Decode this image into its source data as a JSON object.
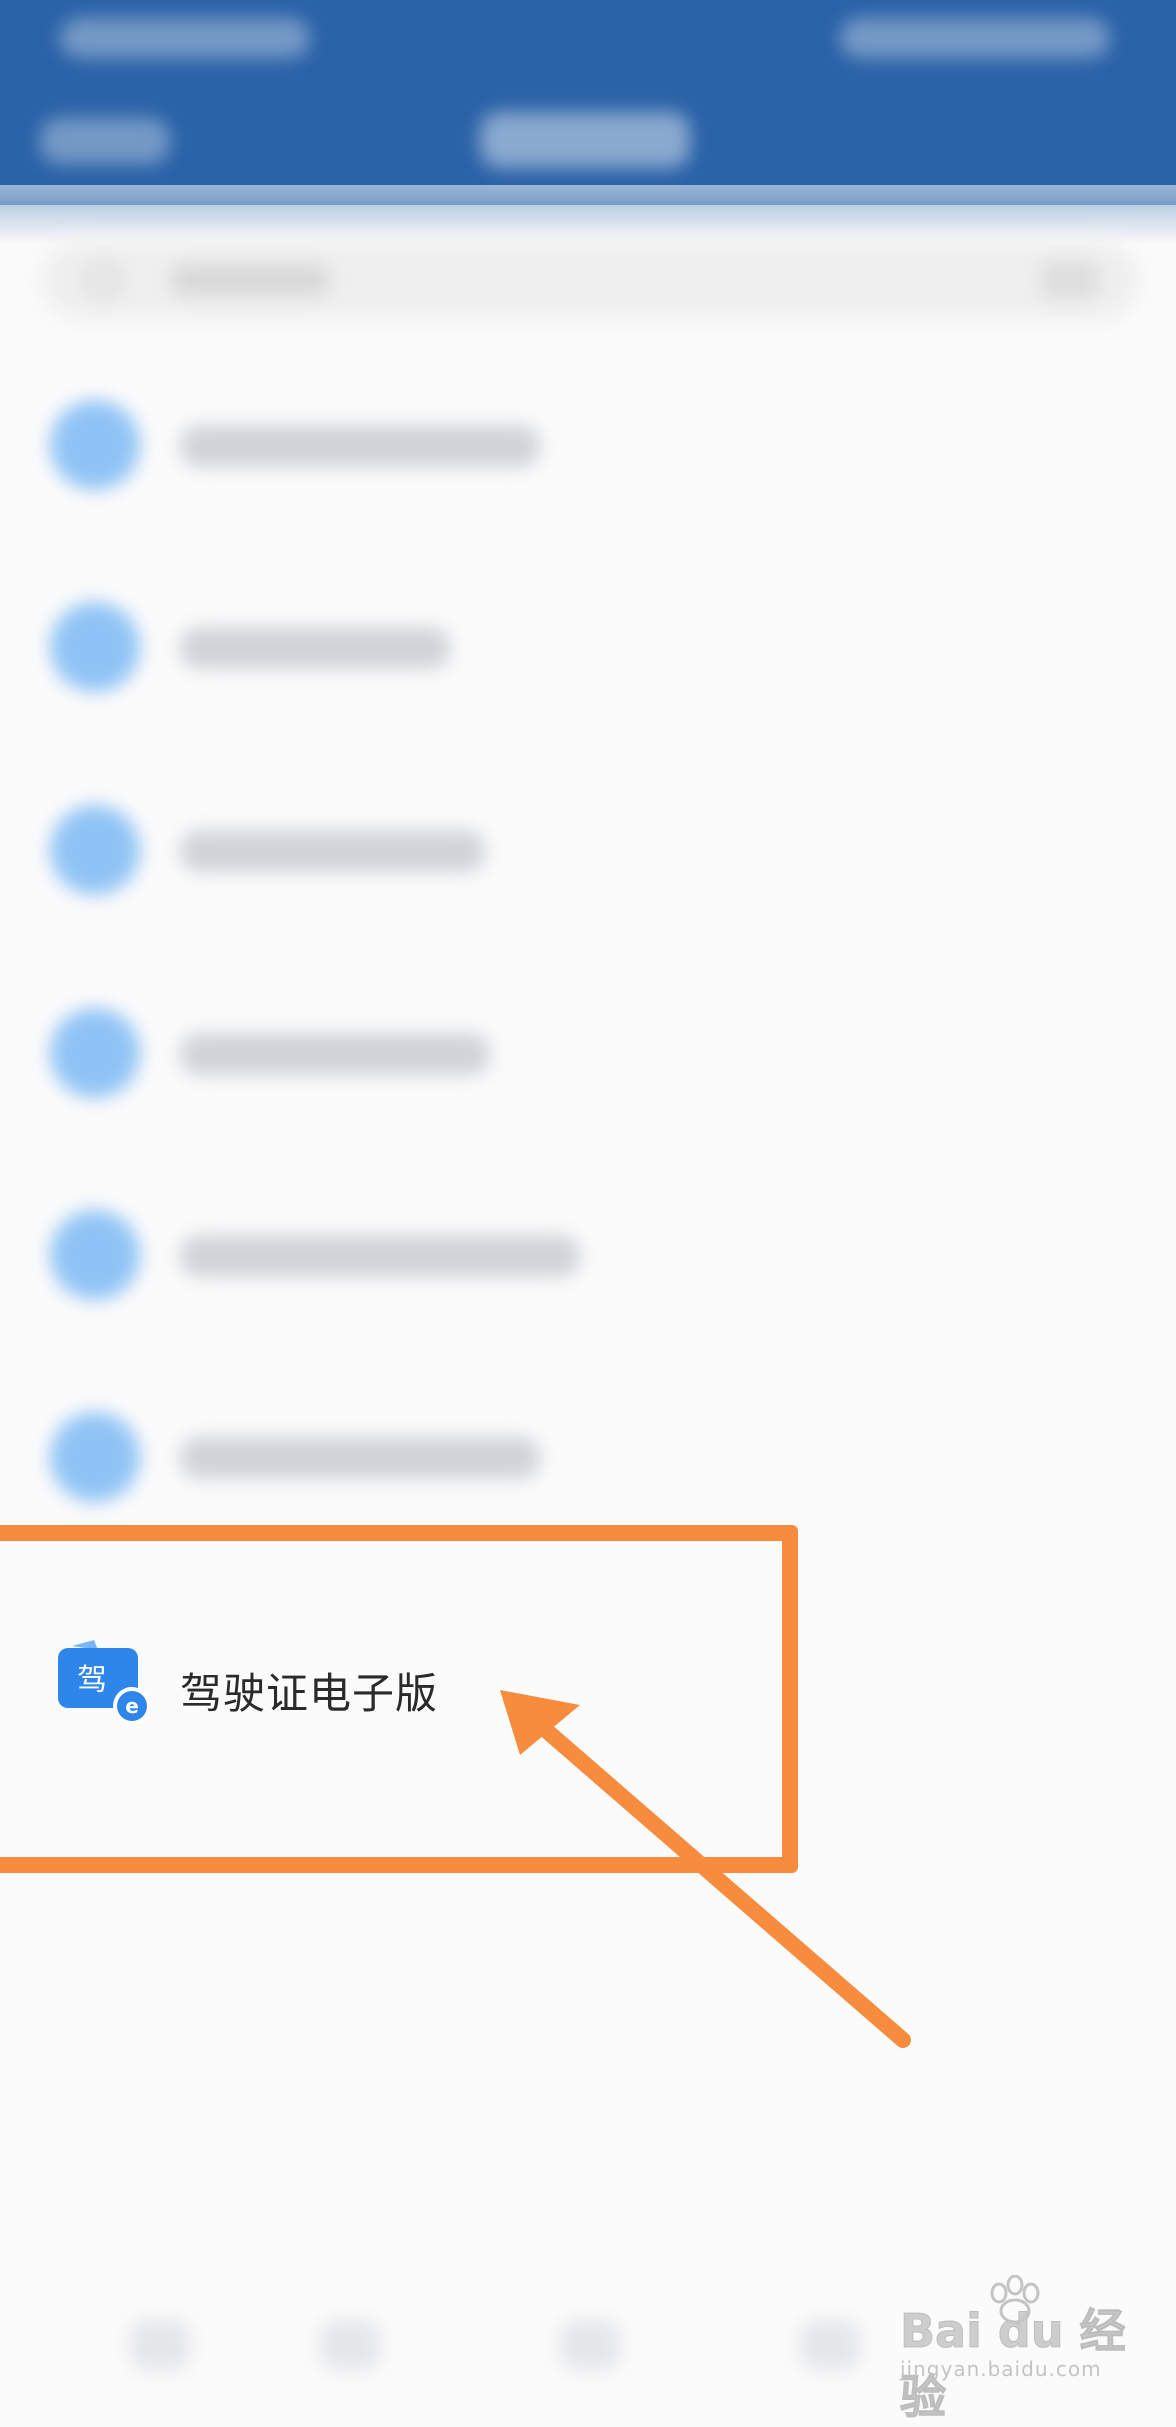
{
  "list": {
    "license_label": "驾驶证电子版",
    "license_icon_char": "驾"
  },
  "watermark": {
    "brand": "Bai du 经验",
    "url": "jingyan.baidu.com"
  },
  "colors": {
    "header": "#2b63a8",
    "accent_blue": "#2f86ea",
    "annotation_orange": "#f78c3e"
  },
  "icons": [
    "search-icon",
    "driver-license-icon",
    "arrow-annotation"
  ]
}
